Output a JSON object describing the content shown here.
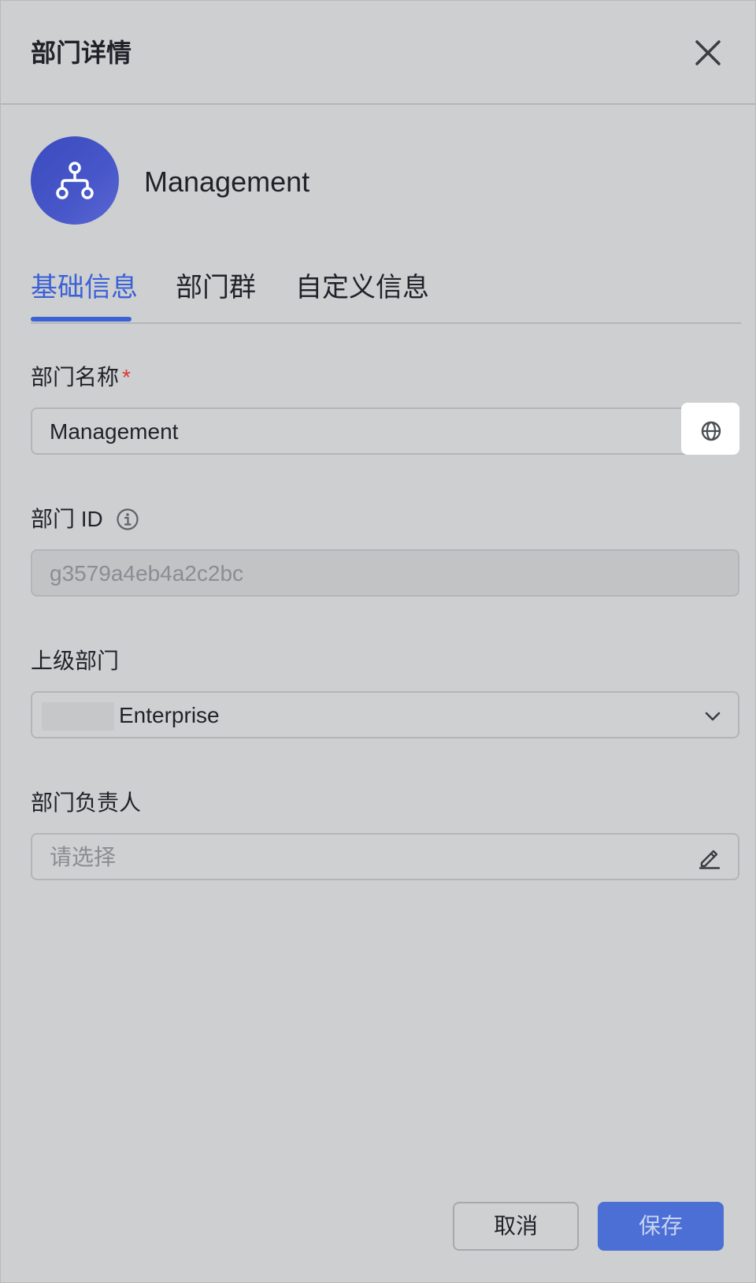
{
  "header": {
    "title": "部门详情",
    "close_icon": "close-icon"
  },
  "department": {
    "name": "Management",
    "avatar_icon": "org-tree-icon",
    "avatar_color": "#4252c6"
  },
  "tabs": [
    {
      "label": "基础信息",
      "active": true
    },
    {
      "label": "部门群",
      "active": false
    },
    {
      "label": "自定义信息",
      "active": false
    }
  ],
  "form": {
    "name": {
      "label": "部门名称",
      "required_mark": "*",
      "value": "Management",
      "icon": "globe-icon"
    },
    "dept_id": {
      "label": "部门 ID",
      "value": "g3579a4eb4a2c2bc",
      "icon": "info-icon"
    },
    "parent": {
      "label": "上级部门",
      "value": "Enterprise",
      "icon": "chevron-down-icon"
    },
    "leader": {
      "label": "部门负责人",
      "placeholder": "请选择",
      "icon": "pencil-icon"
    }
  },
  "footer": {
    "cancel_label": "取消",
    "save_label": "保存"
  },
  "colors": {
    "accent": "#3b61d6",
    "required": "#d83931",
    "panel_bg": "#cecfd0"
  }
}
